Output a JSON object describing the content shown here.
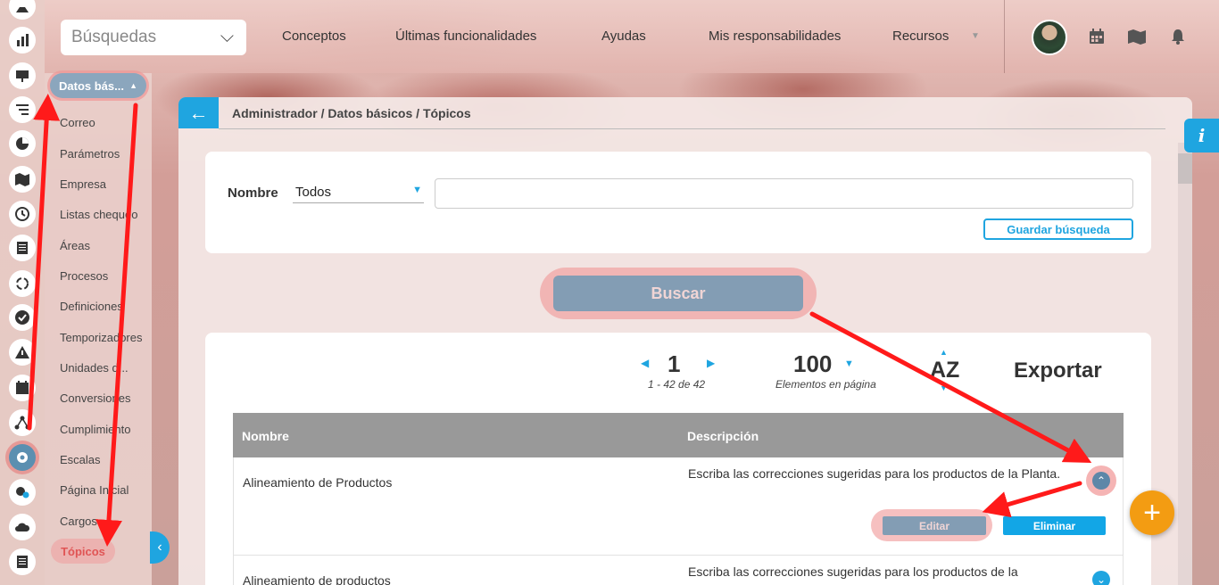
{
  "topbar": {
    "search_select": "Búsquedas",
    "nav": [
      "Conceptos",
      "Últimas funcionalidades",
      "Ayudas",
      "Mis responsabilidades",
      "Recursos"
    ],
    "icons": [
      "calendar-icon",
      "map-icon",
      "bell-icon"
    ]
  },
  "rail": {
    "icons": [
      "user-icon",
      "chart-icon",
      "presentation-icon",
      "filter-icon",
      "pie-icon",
      "map-icon",
      "clock-icon",
      "document-icon",
      "cycle-icon",
      "check-icon",
      "warning-icon",
      "calendar-icon",
      "network-icon",
      "settings-icon",
      "gears-icon",
      "cloud-icon",
      "list-icon"
    ],
    "active": "settings-icon"
  },
  "submenu": {
    "header": "Datos bás...",
    "items": [
      "Correo",
      "Parámetros",
      "Empresa",
      "Listas chequeo",
      "Áreas",
      "Procesos",
      "Definiciones",
      "Temporizadores",
      "Unidades d...",
      "Conversiones",
      "Cumplimiento",
      "Escalas",
      "Página Inicial",
      "Cargos"
    ],
    "selected": "Tópicos"
  },
  "main": {
    "breadcrumb": "Administrador / Datos básicos / Tópicos",
    "info_label": "i"
  },
  "filter": {
    "label": "Nombre",
    "operator": "Todos",
    "value": "",
    "save_label": "Guardar búsqueda",
    "search_label": "Buscar"
  },
  "pager": {
    "page": "1",
    "range": "1 - 42 de 42",
    "per_page": "100",
    "per_page_label": "Elementos en página",
    "sort_label": "AZ",
    "export_label": "Exportar"
  },
  "table": {
    "columns": [
      "Nombre",
      "Descripción"
    ],
    "rows": [
      {
        "name": "Alineamiento de Productos",
        "description": "Escriba las correcciones sugeridas para los productos de la Planta."
      },
      {
        "name": "Alineamiento de productos",
        "description": "Escriba las correcciones sugeridas para los productos de la"
      }
    ],
    "edit_label": "Editar",
    "delete_label": "Eliminar"
  },
  "fab_label": "+",
  "colors": {
    "accent": "#1fa5e0",
    "fab": "#f39c12",
    "annotation": "#ff1a1a"
  }
}
